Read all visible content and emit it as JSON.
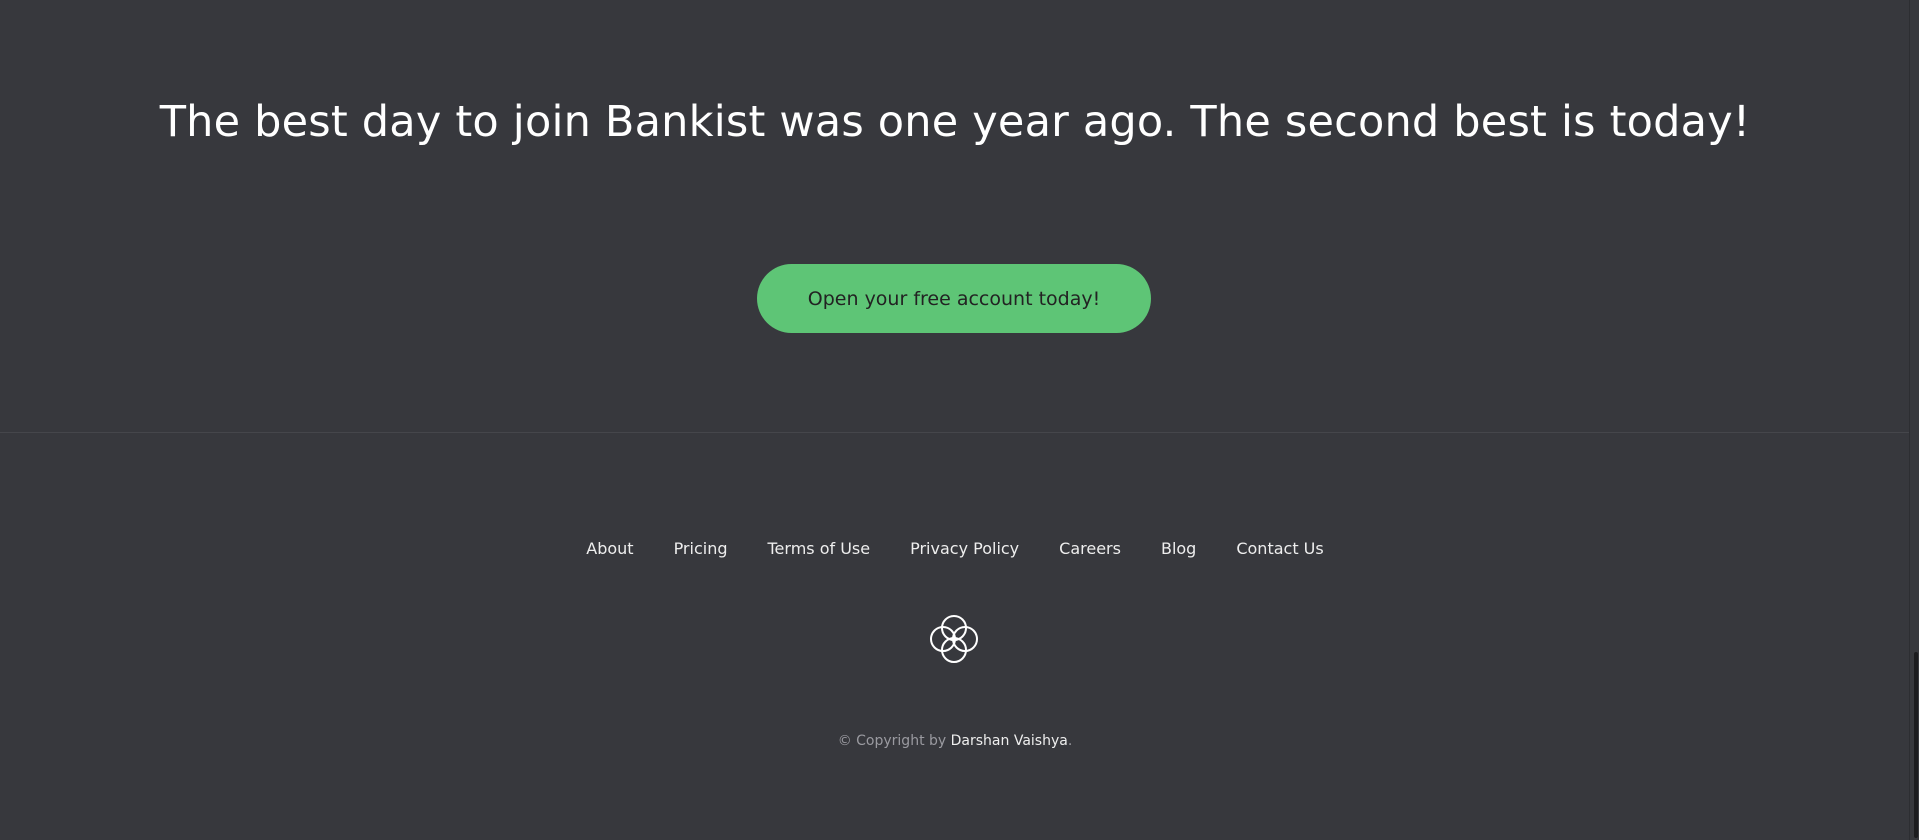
{
  "signup": {
    "title": "The best day to join Bankist was one year ago. The second best is today!",
    "cta_label": "Open your free account today!"
  },
  "colors": {
    "background": "#37383d",
    "accent": "#5ec576",
    "text": "#ffffff"
  },
  "footer": {
    "nav": [
      {
        "label": "About"
      },
      {
        "label": "Pricing"
      },
      {
        "label": "Terms of Use"
      },
      {
        "label": "Privacy Policy"
      },
      {
        "label": "Careers"
      },
      {
        "label": "Blog"
      },
      {
        "label": "Contact Us"
      }
    ],
    "logo_icon": "bankist-logo-icon",
    "copyright_prefix": "© Copyright by ",
    "copyright_author": "Darshan Vaishya",
    "copyright_suffix": "."
  }
}
